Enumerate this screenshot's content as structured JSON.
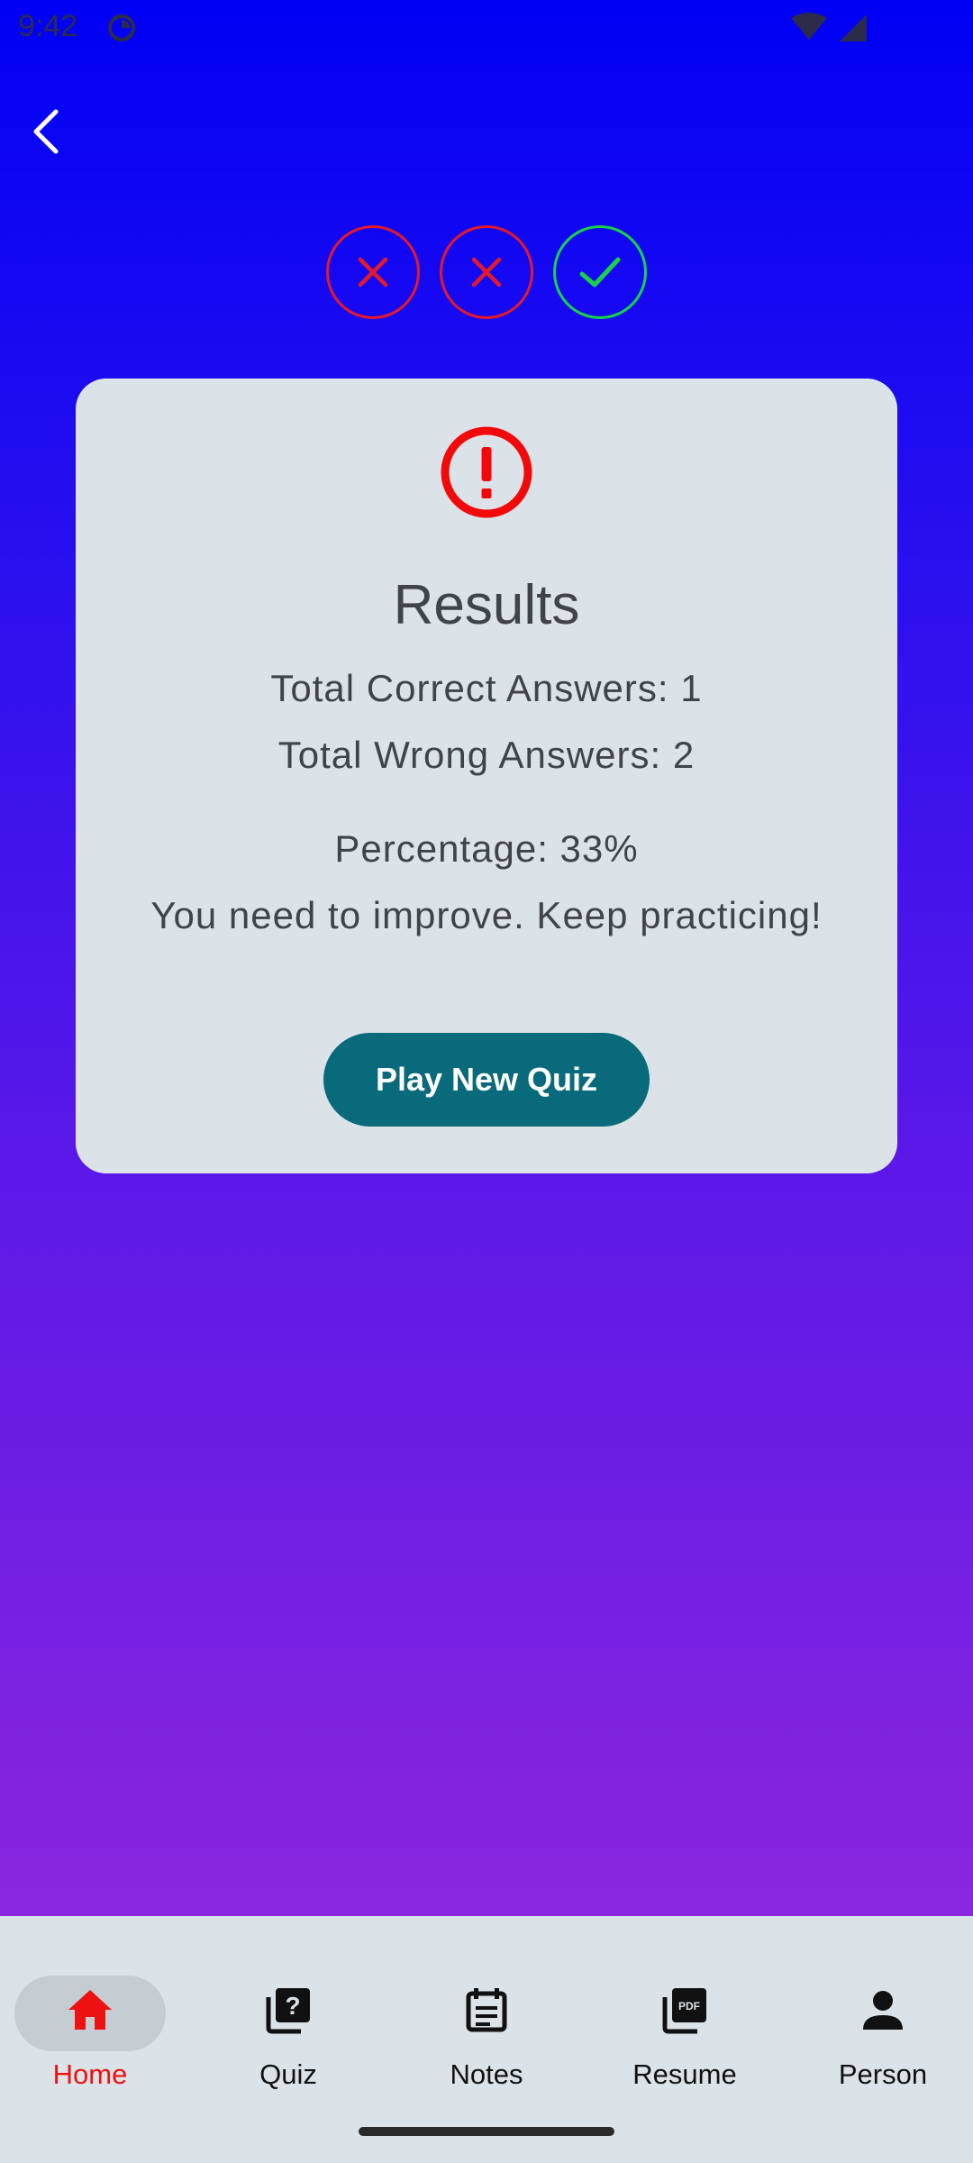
{
  "status_bar": {
    "time": "9:42"
  },
  "header": {
    "back_icon": "chevron-left-icon"
  },
  "answers": [
    {
      "result": "wrong",
      "icon": "close-icon",
      "color": "#e21a2a"
    },
    {
      "result": "wrong",
      "icon": "close-icon",
      "color": "#e21a2a"
    },
    {
      "result": "correct",
      "icon": "check-icon",
      "color": "#18d24a"
    }
  ],
  "results_card": {
    "icon": "alert-circle-icon",
    "title": "Results",
    "total_correct": "Total Correct Answers: 1",
    "total_wrong": "Total Wrong Answers: 2",
    "percentage": "Percentage: 33%",
    "feedback": "You need to improve. Keep practicing!",
    "button_label": "Play New Quiz"
  },
  "bottom_nav": {
    "items": [
      {
        "label": "Home",
        "icon": "home-icon",
        "active": true
      },
      {
        "label": "Quiz",
        "icon": "quiz-icon",
        "active": false
      },
      {
        "label": "Notes",
        "icon": "notes-icon",
        "active": false
      },
      {
        "label": "Resume",
        "icon": "pdf-icon",
        "active": false
      },
      {
        "label": "Person",
        "icon": "person-icon",
        "active": false
      }
    ]
  },
  "colors": {
    "accent": "#ee1111",
    "button": "#086a7a",
    "card": "#dbe3e8",
    "wrong": "#e21a2a",
    "correct": "#18d24a"
  }
}
